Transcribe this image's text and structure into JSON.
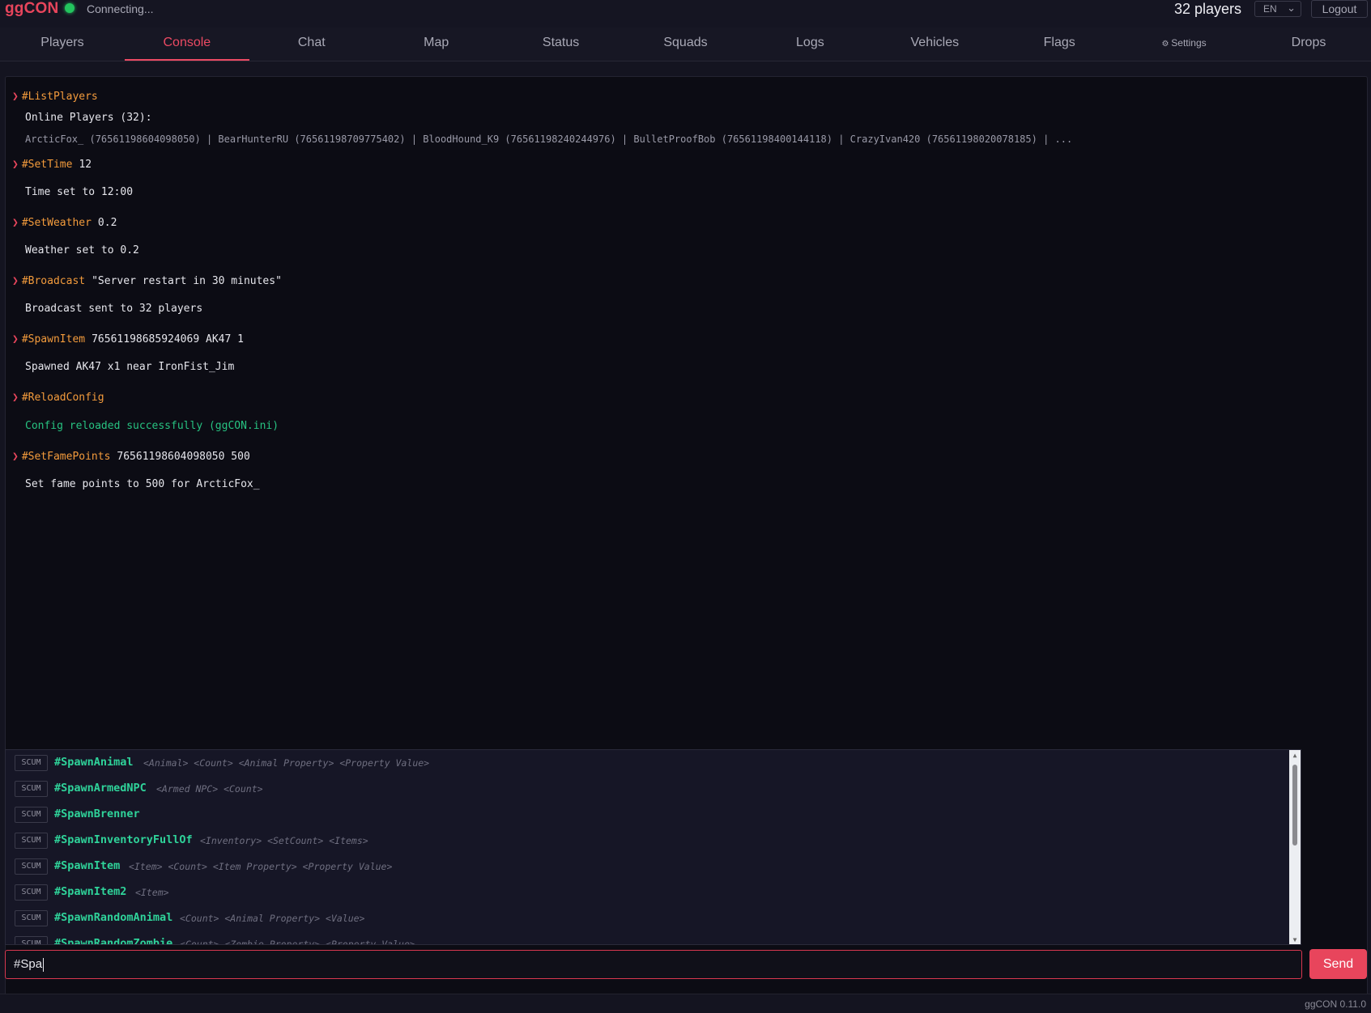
{
  "header": {
    "brand": "ggCON",
    "status_text": "Connecting...",
    "players_count": "32 players",
    "language": "EN",
    "logout_label": "Logout"
  },
  "tabs": [
    "Players",
    "Console",
    "Chat",
    "Map",
    "Status",
    "Squads",
    "Logs",
    "Vehicles",
    "Flags",
    "Settings",
    "Drops"
  ],
  "active_tab": "Console",
  "console": [
    {
      "cmd": "#ListPlayers",
      "args": ""
    },
    {
      "out": "Online Players (32):"
    },
    {
      "out": "ArcticFox_ (76561198604098050) | BearHunterRU (76561198709775402) | BloodHound_K9 (76561198240244976) | BulletProofBob (76561198400144118) | CrazyIvan420 (76561198020078185) | ..."
    },
    {
      "cmd": "#SetTime",
      "args": "12"
    },
    {
      "out": "Time set to 12:00"
    },
    {
      "cmd": "#SetWeather",
      "args": "0.2"
    },
    {
      "out": "Weather set to 0.2"
    },
    {
      "cmd": "#Broadcast",
      "args": "\"Server restart in 30 minutes\""
    },
    {
      "out": "Broadcast sent to 32 players"
    },
    {
      "cmd": "#SpawnItem",
      "args": "76561198685924069 AK47 1"
    },
    {
      "out": "Spawned AK47 x1 near IronFist_Jim"
    },
    {
      "cmd": "#ReloadConfig",
      "args": ""
    },
    {
      "out": "Config reloaded successfully (ggCON.ini)"
    },
    {
      "cmd": "#SetFamePoints",
      "args": "76561198604098050 500"
    },
    {
      "out": "Set fame points to 500 for ArcticFox_"
    }
  ],
  "suggestions": [
    {
      "tag": "SCUM",
      "name": "#SpawnAnimal",
      "args": "<Animal> <Count> <Animal Property> <Property Value>"
    },
    {
      "tag": "SCUM",
      "name": "#SpawnArmedNPC",
      "args": "<Armed NPC> <Count>"
    },
    {
      "tag": "SCUM",
      "name": "#SpawnBrenner",
      "args": ""
    },
    {
      "tag": "SCUM",
      "name": "#SpawnInventoryFullOf",
      "args": "<Inventory> <SetCount> <Items>"
    },
    {
      "tag": "SCUM",
      "name": "#SpawnItem",
      "args": "<Item> <Count> <Item Property> <Property Value>"
    },
    {
      "tag": "SCUM",
      "name": "#SpawnItem2",
      "args": "<Item>"
    },
    {
      "tag": "SCUM",
      "name": "#SpawnRandomAnimal",
      "args": "<Count> <Animal Property> <Value>"
    },
    {
      "tag": "SCUM",
      "name": "#SpawnRandomZombie",
      "args": "<Count> <Zombie Property> <Property Value>"
    }
  ],
  "input": {
    "value": "#Spa"
  },
  "send_label": "Send",
  "version": "ggCON 0.11.0",
  "colors": {
    "accent": "#e8455c",
    "command": "#f39b3c",
    "success": "#27c281",
    "suggestion": "#2fd39a",
    "online": "#23c45e"
  },
  "icons": [
    "chevron-down-icon",
    "gear-icon",
    "prompt-chevron-icon"
  ]
}
